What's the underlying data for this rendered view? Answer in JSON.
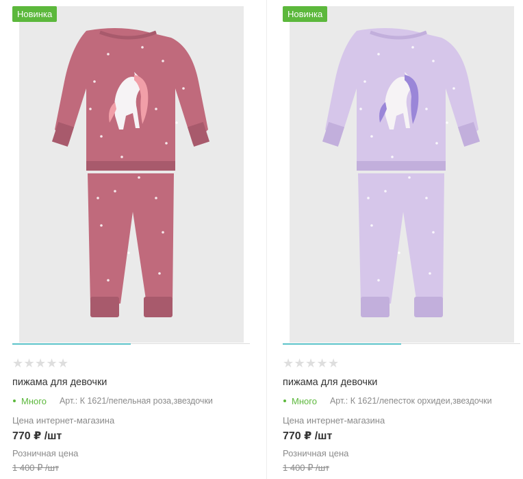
{
  "products": [
    {
      "badge": "Новинка",
      "title": "пижама для девочки",
      "rating": "★★★★★",
      "stock": "Много",
      "sku": "Арт.: К 1621/пепельная роза,звездочки",
      "price_label": "Цена интернет-магазина",
      "price": "770 ₽ /шт",
      "retail_label": "Розничная цена",
      "old_price": "1 400 ₽ /шт",
      "image": {
        "garment_color": "#c06a7c",
        "garment_shade": "#a85a6c",
        "mane_color": "#f19fa8",
        "icon": "unicorn-pajama-image"
      }
    },
    {
      "badge": "Новинка",
      "title": "пижама для девочки",
      "rating": "★★★★★",
      "stock": "Много",
      "sku": "Арт.: К 1621/лепесток орхидеи,звездочки",
      "price_label": "Цена интернет-магазина",
      "price": "770 ₽ /шт",
      "retail_label": "Розничная цена",
      "old_price": "1 400 ₽ /шт",
      "image": {
        "garment_color": "#d6c6ea",
        "garment_shade": "#c2afdc",
        "mane_color": "#9a86d8",
        "icon": "unicorn-pajama-image"
      }
    }
  ],
  "colors": {
    "badge_bg": "#5cb83c",
    "stock_green": "#5cb83c",
    "slider_accent": "#5bc3c9",
    "image_bg": "#eaeaea"
  }
}
